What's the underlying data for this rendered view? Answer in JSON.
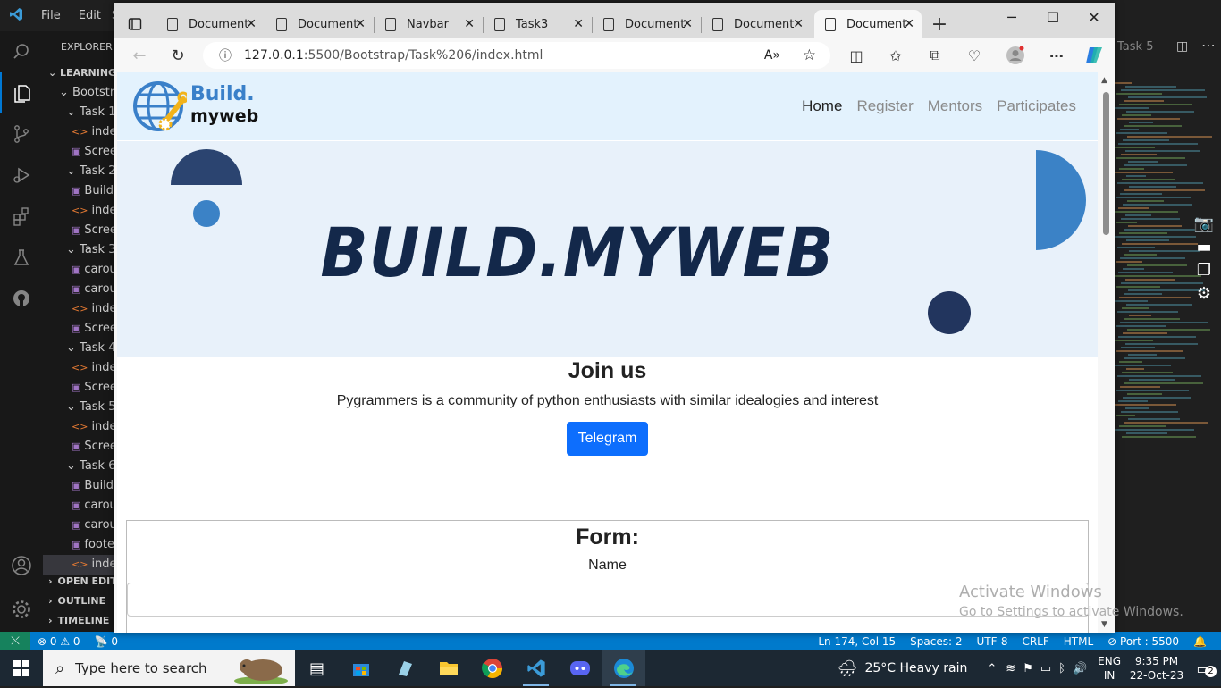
{
  "vscode": {
    "menu": [
      "File",
      "Edit",
      "Se"
    ],
    "explorer_header": "EXPLORER",
    "tree": [
      {
        "label": "LEARNING",
        "type": "section"
      },
      {
        "label": "Bootstra",
        "type": "folder"
      },
      {
        "label": "Task 1",
        "type": "folder"
      },
      {
        "label": "index",
        "type": "html"
      },
      {
        "label": "Scree",
        "type": "img"
      },
      {
        "label": "Task 2",
        "type": "folder"
      },
      {
        "label": "Build",
        "type": "img"
      },
      {
        "label": "index",
        "type": "html"
      },
      {
        "label": "Scree",
        "type": "img"
      },
      {
        "label": "Task 3",
        "type": "folder"
      },
      {
        "label": "carou",
        "type": "img"
      },
      {
        "label": "carou",
        "type": "img"
      },
      {
        "label": "index",
        "type": "html"
      },
      {
        "label": "Scree",
        "type": "img"
      },
      {
        "label": "Task 4",
        "type": "folder"
      },
      {
        "label": "index",
        "type": "html"
      },
      {
        "label": "Scree",
        "type": "img"
      },
      {
        "label": "Task 5",
        "type": "folder"
      },
      {
        "label": "index",
        "type": "html"
      },
      {
        "label": "Scree",
        "type": "img"
      },
      {
        "label": "Task 6",
        "type": "folder"
      },
      {
        "label": "Build",
        "type": "img"
      },
      {
        "label": "carou",
        "type": "img"
      },
      {
        "label": "carou",
        "type": "img"
      },
      {
        "label": "foote",
        "type": "img"
      },
      {
        "label": "index",
        "type": "html"
      }
    ],
    "bottom_sections": [
      "OPEN EDITO",
      "OUTLINE",
      "TIMELINE"
    ],
    "right_tab": "Task 5",
    "status": {
      "errors": "0",
      "warnings": "0",
      "ports": "0",
      "position": "Ln 174, Col 15",
      "spaces": "Spaces: 2",
      "encoding": "UTF-8",
      "eol": "CRLF",
      "language": "HTML",
      "port": "Port : 5500"
    }
  },
  "browser": {
    "tabs": [
      {
        "label": "Document",
        "active": false
      },
      {
        "label": "Document",
        "active": false
      },
      {
        "label": "Navbar",
        "active": false
      },
      {
        "label": "Task3",
        "active": false
      },
      {
        "label": "Document",
        "active": false
      },
      {
        "label": "Document",
        "active": false
      },
      {
        "label": "Document",
        "active": true
      }
    ],
    "url_host": "127.0.0.1",
    "url_path": ":5500/Bootstrap/Task%206/index.html"
  },
  "page": {
    "brand_line1": "Build.",
    "brand_line2": "myweb",
    "nav": [
      "Home",
      "Register",
      "Mentors",
      "Participates"
    ],
    "banner_title": "BUILD.MYWEB",
    "join_title": "Join us",
    "join_text": "Pygrammers is a community of python enthusiasts with similar idealogies and interest",
    "telegram_button": "Telegram",
    "form_title": "Form:",
    "name_label": "Name"
  },
  "watermark": {
    "line1": "Activate Windows",
    "line2": "Go to Settings to activate Windows."
  },
  "taskbar": {
    "search_placeholder": "Type here to search",
    "weather": "25°C  Heavy rain",
    "lang1": "ENG",
    "lang2": "IN",
    "time": "9:35 PM",
    "date": "22-Oct-23",
    "notifications": "2"
  }
}
